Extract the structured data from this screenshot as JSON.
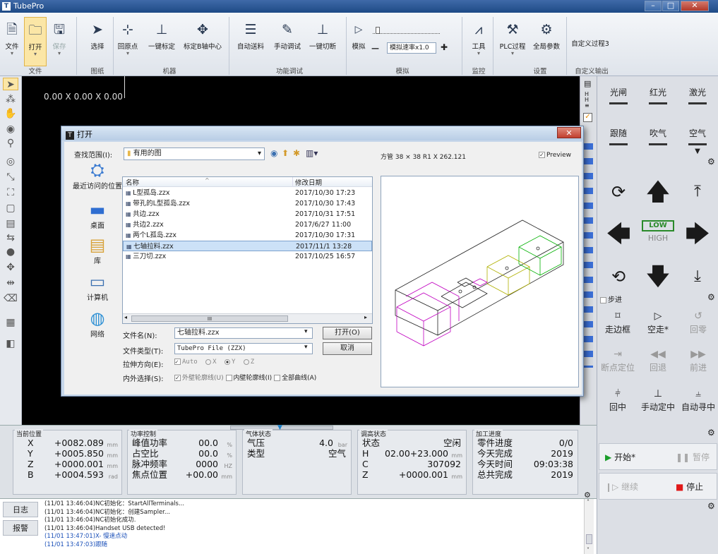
{
  "app": {
    "title": "TubePro",
    "minimize": "–",
    "maximize": "□",
    "close": "✕"
  },
  "ribbon": {
    "buttons": [
      {
        "label": "文件",
        "icon": "file-icon"
      },
      {
        "label": "打开",
        "icon": "folder-icon"
      },
      {
        "label": "保存",
        "icon": "save-icon"
      },
      {
        "label": "选择",
        "icon": "select-arrow-icon"
      },
      {
        "label": "回原点",
        "icon": "home-origin-icon"
      },
      {
        "label": "一键标定",
        "icon": "calibrate-icon"
      },
      {
        "label": "标定B轴中心",
        "icon": "b-axis-center-icon"
      },
      {
        "label": "自动送料",
        "icon": "auto-feed-icon"
      },
      {
        "label": "手动调试",
        "icon": "manual-debug-icon"
      },
      {
        "label": "一键切断",
        "icon": "cut-off-icon"
      },
      {
        "label": "模拟",
        "icon": "simulate-play-icon"
      },
      {
        "label": "工具",
        "icon": "tool-icon"
      },
      {
        "label": "PLC过程",
        "icon": "plc-icon"
      },
      {
        "label": "全局参数",
        "icon": "gear-icon"
      },
      {
        "label": "自定义过程3",
        "icon": ""
      }
    ],
    "groups": [
      "文件",
      "图纸",
      "机器",
      "功能调试",
      "模拟",
      "监控",
      "设置",
      "自定义输出"
    ],
    "sim_speed_label": "模拟速率x1.0",
    "sim_minus": "—",
    "sim_plus": "✚"
  },
  "canvas": {
    "coord_text": "0.00 X 0.00 X 0.00"
  },
  "dialog": {
    "title": "打开",
    "look_in_label": "查找范围(I):",
    "look_in_value": "有用的图",
    "places": [
      "最近访问的位置",
      "桌面",
      "库",
      "计算机",
      "网络"
    ],
    "columns": {
      "name": "名称",
      "date": "修改日期"
    },
    "files": [
      {
        "name": "L型孤岛.zzx",
        "date": "2017/10/30 17:23"
      },
      {
        "name": "带孔的L型孤岛.zzx",
        "date": "2017/10/30 17:43"
      },
      {
        "name": "共边.zzx",
        "date": "2017/10/31 17:51"
      },
      {
        "name": "共边2.zzx",
        "date": "2017/6/27 11:00"
      },
      {
        "name": "两个L孤岛.zzx",
        "date": "2017/10/30 17:31"
      },
      {
        "name": "七轴拉料.zzx",
        "date": "2017/11/1 13:28"
      },
      {
        "name": "三刀切.zzx",
        "date": "2017/10/25 16:57"
      }
    ],
    "selected_index": 5,
    "filename_label": "文件名(N):",
    "filename_value": "七轴拉料.zzx",
    "filetype_label": "文件类型(T):",
    "filetype_value": "TubePro File (ZZX)",
    "open_button": "打开(O)",
    "cancel_button": "取消",
    "stretch_label": "拉伸方向(E):",
    "stretch_auto": "Auto",
    "stretch_x": "X",
    "stretch_y": "Y",
    "stretch_z": "Z",
    "inout_label": "内外选择(S):",
    "outer": "外壁轮廓线(U)",
    "inner": "内壁轮廓线(I)",
    "all": "全部曲线(A)",
    "preview_info": "方管 38 × 38 R1 X 262.121",
    "preview_check": "Preview",
    "scroll_thumb": "III"
  },
  "right_panel": {
    "toggles": [
      "光闸",
      "红光",
      "激光",
      "跟随",
      "吹气",
      "空气"
    ],
    "low": "LOW",
    "high": "HIGH",
    "step": "步进",
    "actions": [
      "走边框",
      "空走*",
      "回零",
      "断点定位",
      "回退",
      "前进",
      "回中",
      "手动定中",
      "自动寻中"
    ],
    "start": "开始*",
    "pause": "暂停",
    "resume": "继续",
    "stop": "停止",
    "colors": {
      "start": "#1a9d2a",
      "stop": "#e01818"
    }
  },
  "status": {
    "position": {
      "title": "当前位置",
      "rows": [
        {
          "axis": "X",
          "value": "+0082.089",
          "unit": "mm"
        },
        {
          "axis": "Y",
          "value": "+0005.850",
          "unit": "mm"
        },
        {
          "axis": "Z",
          "value": "+0000.001",
          "unit": "mm"
        },
        {
          "axis": "B",
          "value": "+0004.593",
          "unit": "rad"
        }
      ]
    },
    "power": {
      "title": "功率控制",
      "rows": [
        {
          "label": "峰值功率",
          "value": "00.0",
          "unit": "%"
        },
        {
          "label": "占空比",
          "value": "00.0",
          "unit": "%"
        },
        {
          "label": "脉冲频率",
          "value": "0000",
          "unit": "HZ"
        },
        {
          "label": "焦点位置",
          "value": "+00.00",
          "unit": "mm"
        }
      ]
    },
    "gas": {
      "title": "气体状态",
      "rows": [
        {
          "label": "气压",
          "value": "4.0",
          "unit": "bar"
        },
        {
          "label": "类型",
          "value": "空气",
          "unit": ""
        }
      ]
    },
    "height": {
      "title": "调高状态",
      "rows": [
        {
          "label": "状态",
          "value": "空闲",
          "unit": ""
        },
        {
          "label": "H",
          "value": "02.00+23.000",
          "unit": "mm"
        },
        {
          "label": "C",
          "value": "307092",
          "unit": ""
        },
        {
          "label": "Z",
          "value": "+0000.001",
          "unit": "mm"
        }
      ]
    },
    "progress": {
      "title": "加工进度",
      "rows": [
        {
          "label": "零件进度",
          "value": "0/0"
        },
        {
          "label": "今天完成",
          "value": "2019"
        },
        {
          "label": "今天时间",
          "value": "09:03:38"
        },
        {
          "label": "总共完成",
          "value": "2019"
        }
      ]
    }
  },
  "log": {
    "tabs": [
      "日志",
      "报警"
    ],
    "lines": [
      "(11/01 13:46:04)NC初始化：StartAllTerminals...",
      "(11/01 13:46:04)NC初始化：创建Sampler...",
      "(11/01 13:46:04)NC初始化成功.",
      "(11/01 13:46:04)Handset USB detected!",
      "(11/01 13:47:01)X- 慢速点动",
      "(11/01 13:47:03)跟随"
    ]
  },
  "left_toolbar_icons": [
    "select-icon",
    "node-icon",
    "pan-icon",
    "view-icon",
    "zoom-icon",
    "circle-icon",
    "scale-icon",
    "frame-icon",
    "rect-icon",
    "array-icon",
    "swap-icon",
    "drop-icon",
    "move-icon",
    "distribute-icon",
    "eraser-icon",
    "grid-icon",
    "sort-icon"
  ]
}
